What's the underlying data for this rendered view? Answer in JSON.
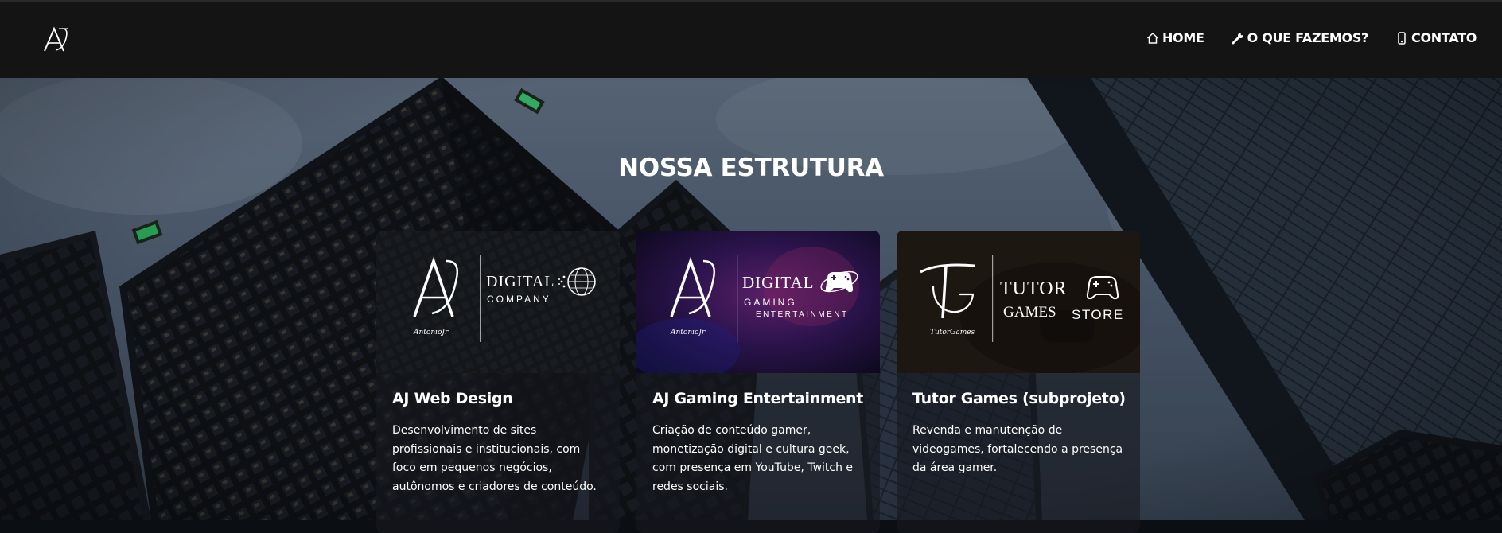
{
  "nav": {
    "items": [
      {
        "icon": "home-icon",
        "label": "HOME"
      },
      {
        "icon": "wrench-icon",
        "label": "O QUE FAZEMOS?"
      },
      {
        "icon": "phone-icon",
        "label": "CONTATO"
      }
    ]
  },
  "section": {
    "title": "NOSSA ESTRUTURA"
  },
  "cards": [
    {
      "title": "AJ Web Design",
      "text": "Desenvolvimento de sites profissionais e institucionais, com foco em pequenos negócios, autônomos e criadores de conteúdo.",
      "banner": {
        "line1": "DIGITAL",
        "line2": "COMPANY",
        "signature": "AntonioJr"
      }
    },
    {
      "title": "AJ Gaming Entertainment",
      "text": "Criação de conteúdo gamer, monetização digital e cultura geek, com presença em YouTube, Twitch e redes sociais.",
      "banner": {
        "line1": "DIGITAL",
        "line2": "GAMING",
        "line3": "ENTERTAINMENT",
        "signature": "AntonioJr"
      }
    },
    {
      "title": "Tutor Games (subprojeto)",
      "text": "Revenda e manutenção de videogames, fortalecendo a presença da área gamer.",
      "banner": {
        "line1": "TUTOR",
        "line2": "GAMES",
        "line3": "STORE",
        "signature": "TutorGames"
      }
    }
  ],
  "colors": {
    "header": "#141414",
    "page_text": "#ffffff",
    "sky": "#5d6d80",
    "building": "#15181d"
  }
}
